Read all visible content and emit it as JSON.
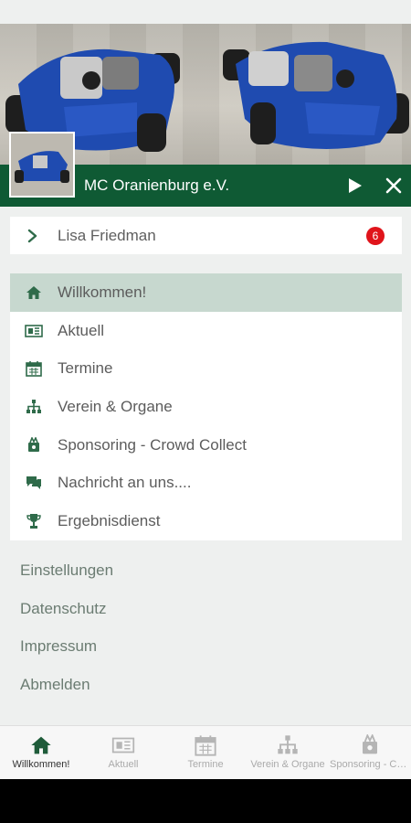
{
  "header": {
    "club_name": "MC Oranienburg e.V.",
    "play_icon": "play-icon",
    "close_icon": "close-icon"
  },
  "user": {
    "name": "Lisa Friedman",
    "notification_count": "6"
  },
  "menu": {
    "items": [
      {
        "label": "Willkommen!",
        "icon": "home-icon",
        "active": true
      },
      {
        "label": "Aktuell",
        "icon": "news-icon",
        "active": false
      },
      {
        "label": "Termine",
        "icon": "calendar-icon",
        "active": false
      },
      {
        "label": "Verein & Organe",
        "icon": "org-chart-icon",
        "active": false
      },
      {
        "label": "Sponsoring - Crowd Collect",
        "icon": "sponsoring-icon",
        "active": false
      },
      {
        "label": "Nachricht an uns....",
        "icon": "chat-icon",
        "active": false
      },
      {
        "label": "Ergebnisdienst",
        "icon": "trophy-icon",
        "active": false
      }
    ]
  },
  "links": [
    "Einstellungen",
    "Datenschutz",
    "Impressum",
    "Abmelden"
  ],
  "tabs": [
    {
      "label": "Willkommen!",
      "icon": "home-icon",
      "active": true
    },
    {
      "label": "Aktuell",
      "icon": "news-icon",
      "active": false
    },
    {
      "label": "Termine",
      "icon": "calendar-icon",
      "active": false
    },
    {
      "label": "Verein & Organe",
      "icon": "org-chart-icon",
      "active": false
    },
    {
      "label": "Sponsoring - Crowd Collect",
      "icon": "sponsoring-icon",
      "active": false
    }
  ],
  "colors": {
    "brand_green": "#0f5a34",
    "active_row": "#c7d8cf",
    "badge_red": "#e0141b",
    "icon_green": "#2f6b4a"
  }
}
